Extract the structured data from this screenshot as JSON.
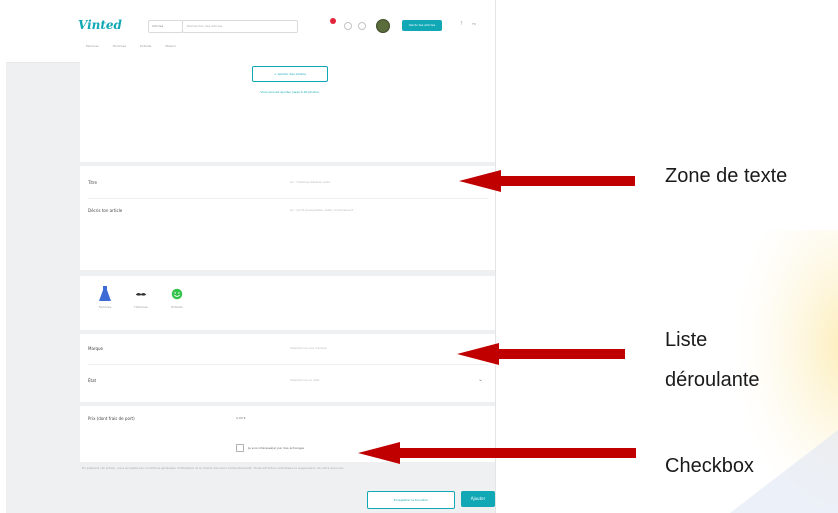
{
  "screenshot": {
    "logo": "Vinted",
    "header": {
      "category_select": "Articles",
      "search_placeholder": "Rechercher des articles",
      "sell_button": "Vends tes articles",
      "help_icon": "question-icon",
      "language": "FR"
    },
    "nav": [
      "Femmes",
      "Hommes",
      "Enfants",
      "Maison"
    ],
    "photo_section": {
      "add_photos_button": "Ajouter des photos",
      "hint": "Vous pouvez ajouter jusqu'à 20 photos."
    },
    "title_row": {
      "label": "Titre",
      "placeholder": "ex : Chemise Sézane verte"
    },
    "description_row": {
      "label": "Décris ton article",
      "placeholder": "ex : porté quelquefois, taille correctement"
    },
    "categories": [
      {
        "label": "Femmes",
        "icon": "dress-icon",
        "color": "#3d6bd6"
      },
      {
        "label": "Hommes",
        "icon": "mustache-icon",
        "color": "#333333"
      },
      {
        "label": "Enfants",
        "icon": "smiley-icon",
        "color": "#35c24a"
      }
    ],
    "brand_row": {
      "label": "Marque",
      "placeholder": "Sélectionne une marque"
    },
    "state_row": {
      "label": "État",
      "placeholder": "Sélectionne un état"
    },
    "price_row": {
      "label": "Prix (dont frais de port)",
      "value": "0,00 €"
    },
    "checkbox": {
      "label": "Je suis intéressé(e) par des échanges",
      "checked": false
    },
    "footnote": "En publiant cet article, vous acceptez les conditions générales d'utilisation et la charte des bons comportements. Toute infraction entraînera la suppression de votre annonce.",
    "buttons": {
      "draft": "Enregistrer le brouillon",
      "submit": "Ajouter"
    },
    "accent_color": "#10a8b5"
  },
  "annotations": {
    "text_zone": "Zone de texte",
    "dropdown_line1": "Liste",
    "dropdown_line2": "déroulante",
    "checkbox": "Checkbox"
  },
  "arrow_color": "#c00000"
}
